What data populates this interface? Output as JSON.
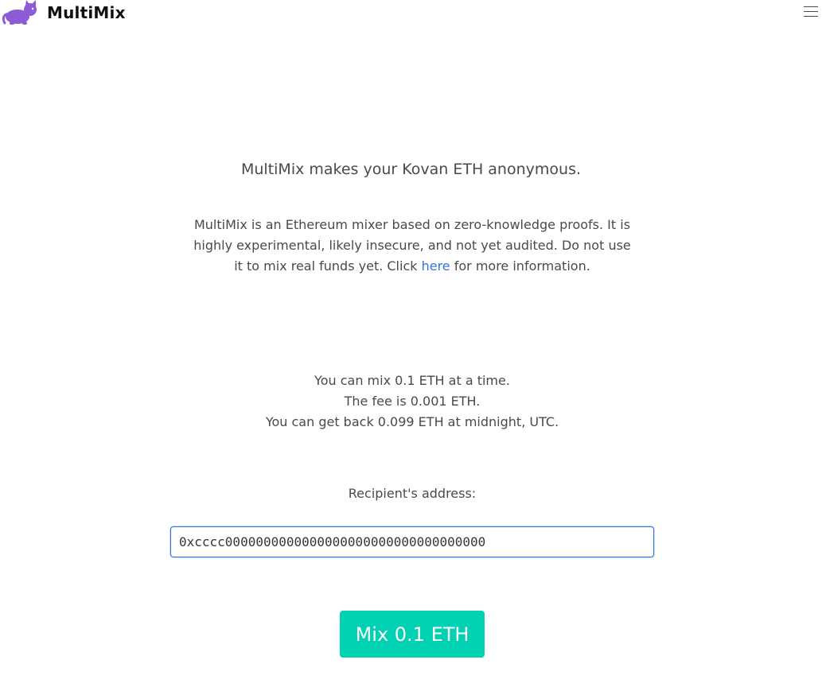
{
  "navbar": {
    "brand_name": "MultiMix",
    "logo_icon": "cat-icon",
    "menu_icon": "hamburger-menu-icon",
    "logo_color": "#8e5bd6"
  },
  "main": {
    "title": "MultiMix makes your Kovan ETH anonymous.",
    "intro_before_link": "MultiMix is an Ethereum mixer based on zero-knowledge proofs. It is highly experimental, likely insecure, and not yet audited. Do not use it to mix real funds yet. Click ",
    "intro_link": "here",
    "intro_after_link": " for more information.",
    "info_lines": [
      "You can mix 0.1 ETH at a time.",
      "The fee is 0.001 ETH.",
      "You can get back 0.099 ETH at midnight, UTC."
    ],
    "recipient_label": "Recipient's address:",
    "recipient_value": "0xcccc0000000000000000000000000000000000",
    "mix_button_label": "Mix 0.1 ETH",
    "accent_color": "#00d1b2",
    "link_color": "#3273dc"
  }
}
